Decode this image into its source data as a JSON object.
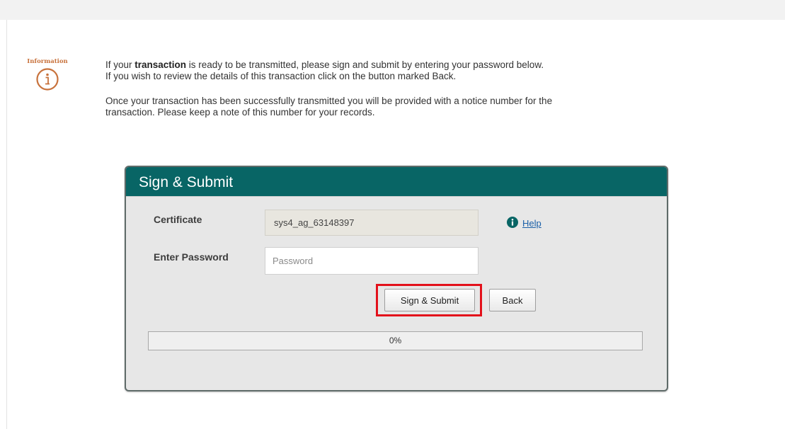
{
  "info": {
    "label": "Information",
    "icon": "info-circle-icon"
  },
  "intro": {
    "line1_pre": "If your ",
    "line1_bold": "transaction",
    "line1_post": " is ready to be transmitted, please sign and submit by entering your password below.",
    "line2": "If you wish to review the details of this transaction click on the button marked Back.",
    "line3": "Once your transaction has been successfully transmitted you will be provided with a notice number for the",
    "line4": "transaction. Please keep a note of this number for your records."
  },
  "panel": {
    "title": "Sign & Submit",
    "certificate_label": "Certificate",
    "certificate_value": "sys4_ag_63148397",
    "help_label": "Help",
    "password_label": "Enter Password",
    "password_placeholder": "Password",
    "password_value": "",
    "submit_label": "Sign & Submit",
    "back_label": "Back",
    "progress_text": "0%",
    "progress_value": 0
  },
  "colors": {
    "header": "#086565",
    "info_accent": "#c8723c",
    "highlight": "#e3111b",
    "link": "#1a5fa8"
  }
}
